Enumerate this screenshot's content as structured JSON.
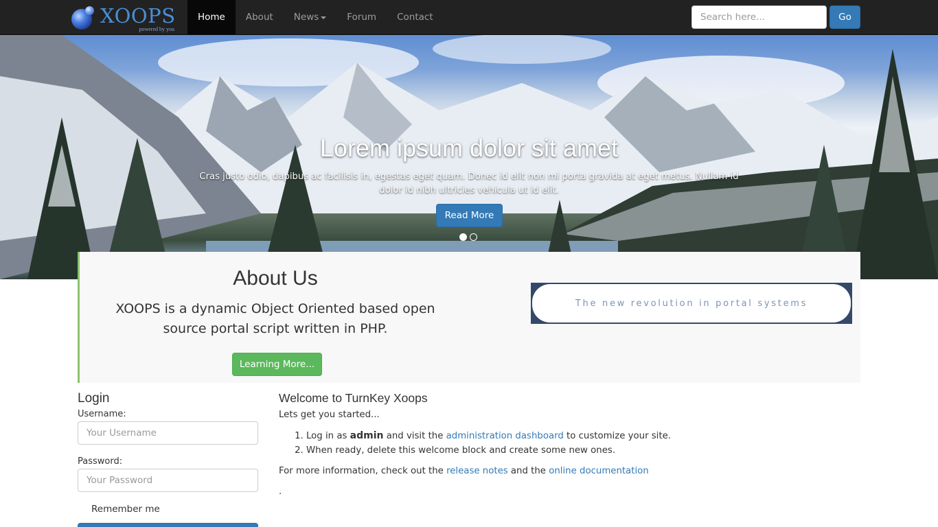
{
  "brand": {
    "name": "XOOPS",
    "tagline": "powered by you"
  },
  "nav": {
    "items": [
      {
        "label": "Home",
        "active": true
      },
      {
        "label": "About"
      },
      {
        "label": "News",
        "dropdown": true
      },
      {
        "label": "Forum"
      },
      {
        "label": "Contact"
      }
    ]
  },
  "search": {
    "placeholder": "Search here...",
    "button": "Go"
  },
  "hero": {
    "title": "Lorem ipsum dolor sit amet",
    "text": "Cras justo odio, dapibus ac facilisis in, egestas eget quam. Donec id elit non mi porta gravida at eget metus. Nullam id dolor id nibh ultricies vehicula ut id elit.",
    "button": "Read More",
    "slides": 2,
    "active_slide": 1
  },
  "about": {
    "title": "About Us",
    "text": "XOOPS is a dynamic Object Oriented based open source portal script written in PHP.",
    "button": "Learning More...",
    "banner": "The new revolution in portal systems"
  },
  "login": {
    "title": "Login",
    "username_label": "Username:",
    "username_placeholder": "Your Username",
    "password_label": "Password:",
    "password_placeholder": "Your Password",
    "remember": "Remember me"
  },
  "welcome": {
    "title": "Welcome to TurnKey Xoops",
    "intro": "Lets get you started...",
    "step1_pre": "Log in as ",
    "step1_user": "admin",
    "step1_mid": " and visit the ",
    "step1_link": "administration dashboard",
    "step1_post": " to customize your site.",
    "step2": "When ready, delete this welcome block and create some new ones.",
    "more_pre": "For more information, check out the ",
    "more_link1": "release notes",
    "more_mid": " and the ",
    "more_link2": "online documentation",
    "trailing": "."
  },
  "colors": {
    "navbar": "#222222",
    "primary": "#337ab7",
    "success": "#5cb85c",
    "about_accent": "#8dc26f",
    "link": "#337ab7"
  }
}
